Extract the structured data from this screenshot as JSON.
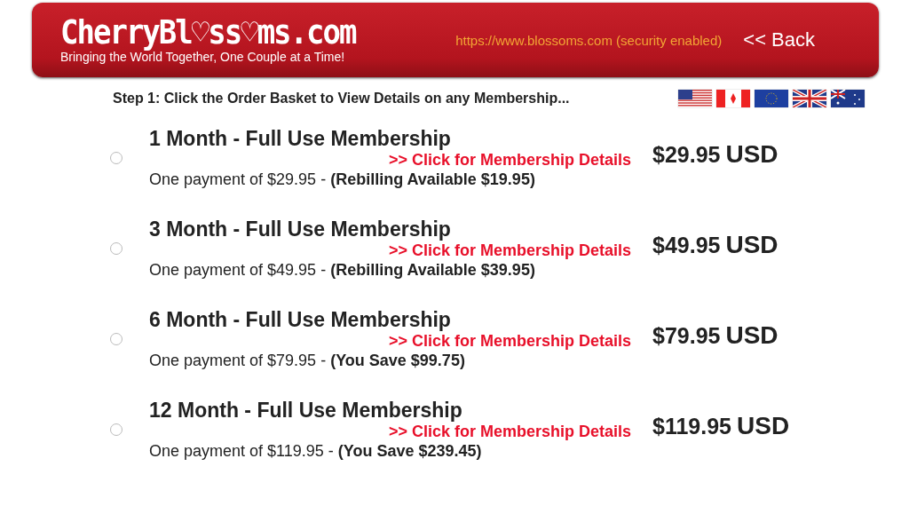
{
  "header": {
    "logo": "CherryBl♡ss♡ms.com",
    "tagline": "Bringing the World Together, One Couple at a Time!",
    "security": "https://www.blossoms.com (security enabled)",
    "back": "<< Back"
  },
  "step": "Step 1: Click the Order Basket to View Details on any Membership...",
  "flags": [
    {
      "kind": "us"
    },
    {
      "kind": "ca"
    },
    {
      "kind": "eu"
    },
    {
      "kind": "uk"
    },
    {
      "kind": "au"
    }
  ],
  "plans": [
    {
      "title": "1 Month - Full Use Membership",
      "link": ">> Click for Membership Details",
      "payment": "One payment of $29.95 - **(Rebilling Available $19.95)**",
      "price": "$29.95",
      "currency": "USD",
      "selected": false
    },
    {
      "title": "3 Month - Full Use Membership",
      "link": ">> Click for Membership Details",
      "payment": "One payment of $49.95 - **(Rebilling Available $39.95)**",
      "price": "$49.95",
      "currency": "USD",
      "selected": false
    },
    {
      "title": "6 Month - Full Use Membership",
      "link": ">> Click for Membership Details",
      "payment": "One payment of $79.95 - **(You Save $99.75)**",
      "price": "$79.95",
      "currency": "USD",
      "selected": false
    },
    {
      "title": "12 Month - Full Use Membership",
      "link": ">> Click for Membership Details",
      "payment": "One payment of $119.95 - **(You Save $239.45)**",
      "price": "$119.95",
      "currency": "USD",
      "selected": false
    }
  ]
}
